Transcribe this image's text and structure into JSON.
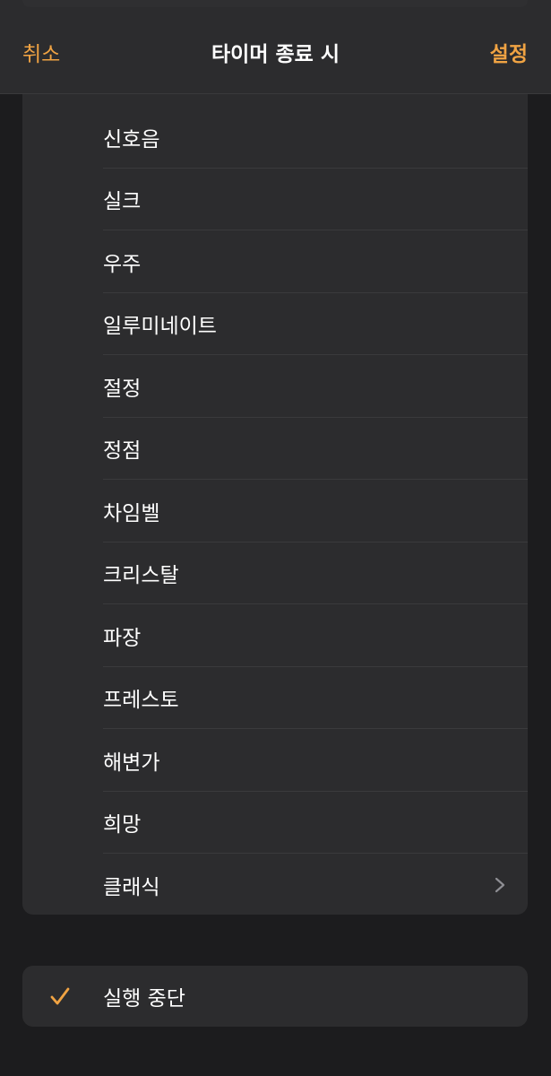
{
  "header": {
    "cancel_label": "취소",
    "title": "타이머 종료 시",
    "set_label": "설정"
  },
  "sounds": [
    {
      "label": "신호음"
    },
    {
      "label": "실크"
    },
    {
      "label": "우주"
    },
    {
      "label": "일루미네이트"
    },
    {
      "label": "절정"
    },
    {
      "label": "정점"
    },
    {
      "label": "차임벨"
    },
    {
      "label": "크리스탈"
    },
    {
      "label": "파장"
    },
    {
      "label": "프레스토"
    },
    {
      "label": "해변가"
    },
    {
      "label": "희망"
    },
    {
      "label": "클래식"
    }
  ],
  "stop_option": {
    "label": "실행 중단",
    "selected": true
  },
  "colors": {
    "accent": "#f0a343",
    "background": "#1c1c1e",
    "card": "#2c2c2e",
    "separator": "#3a3a3c"
  },
  "icons": {
    "chevron": "chevron-right-icon",
    "check": "checkmark-icon"
  }
}
